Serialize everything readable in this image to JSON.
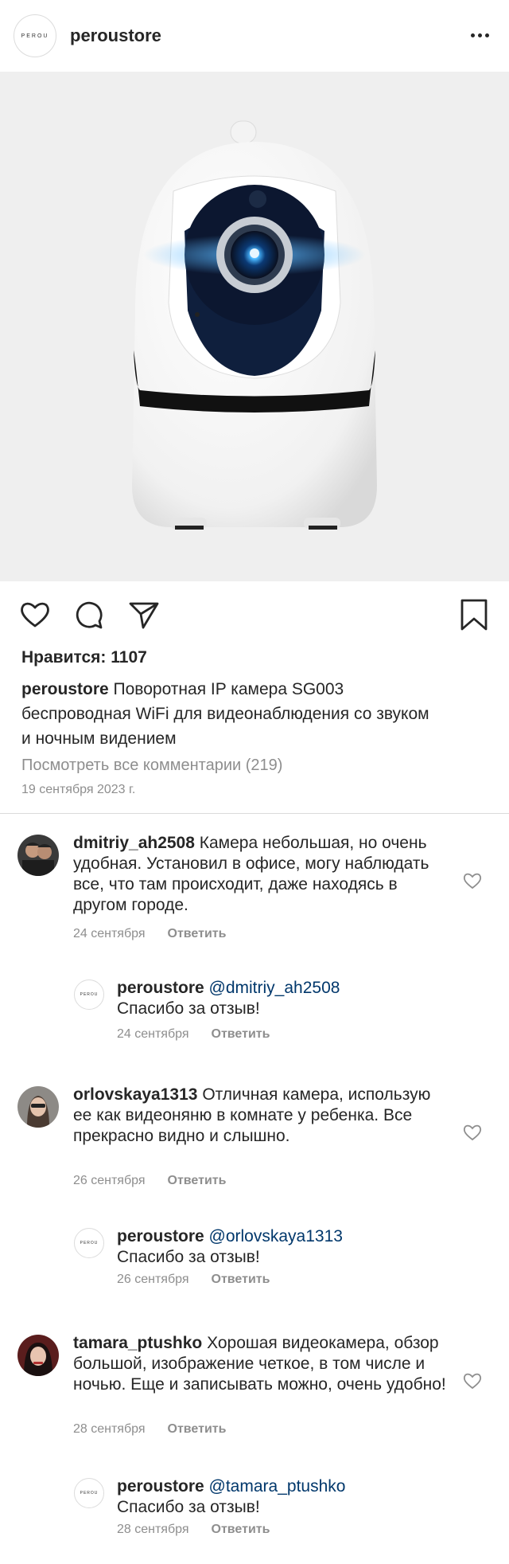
{
  "header": {
    "brand_logo_text": "PEROU",
    "username": "peroustore"
  },
  "post": {
    "likes_text": "Нравится: 1107",
    "caption_user": "peroustore",
    "caption_text": "Поворотная IP камера SG003 беспроводная WiFi для видеонаблюдения со звуком и ночным видением",
    "view_all_comments": "Посмотреть все комментарии (219)",
    "date": "19 сентября 2023 г."
  },
  "comments": [
    {
      "user": "dmitriy_ah2508",
      "text": "Камера небольшая, но очень удобная. Установил в офисе, могу наблюдать все, что там происходит, даже находясь в другом городе.",
      "date": "24 сентября",
      "reply_label": "Ответить",
      "reply": {
        "user": "peroustore",
        "mention": "@dmitriy_ah2508",
        "text": "Спасибо за отзыв!",
        "date": "24 сентября",
        "reply_label": "Ответить"
      }
    },
    {
      "user": "orlovskaya1313",
      "text": "Отличная камера, использую ее как видеоняню в комнате у ребенка. Все прекрасно видно и слышно.",
      "date": "26 сентября",
      "reply_label": "Ответить",
      "reply": {
        "user": "peroustore",
        "mention": "@orlovskaya1313",
        "text": "Спасибо за отзыв!",
        "date": "26 сентября",
        "reply_label": "Ответить"
      }
    },
    {
      "user": "tamara_ptushko",
      "text": "Хорошая видеокамера, обзор большой, изображение четкое, в том числе и ночью. Еще и записывать можно, очень удобно!",
      "date": "28 сентября",
      "reply_label": "Ответить",
      "reply": {
        "user": "peroustore",
        "mention": "@tamara_ptushko",
        "text": "Спасибо за отзыв!",
        "date": "28 сентября",
        "reply_label": "Ответить"
      }
    }
  ],
  "icons": {
    "like": "heart-icon",
    "comment": "comment-icon",
    "share": "send-icon",
    "save": "bookmark-icon",
    "more": "more-icon",
    "comment_like": "heart-small-icon"
  },
  "colors": {
    "text": "#262626",
    "muted": "#8e8e8e",
    "mention": "#00376b",
    "divider": "#dbdbdb",
    "photo_bg": "#efefef",
    "lens_glow": "#1e90ff"
  }
}
